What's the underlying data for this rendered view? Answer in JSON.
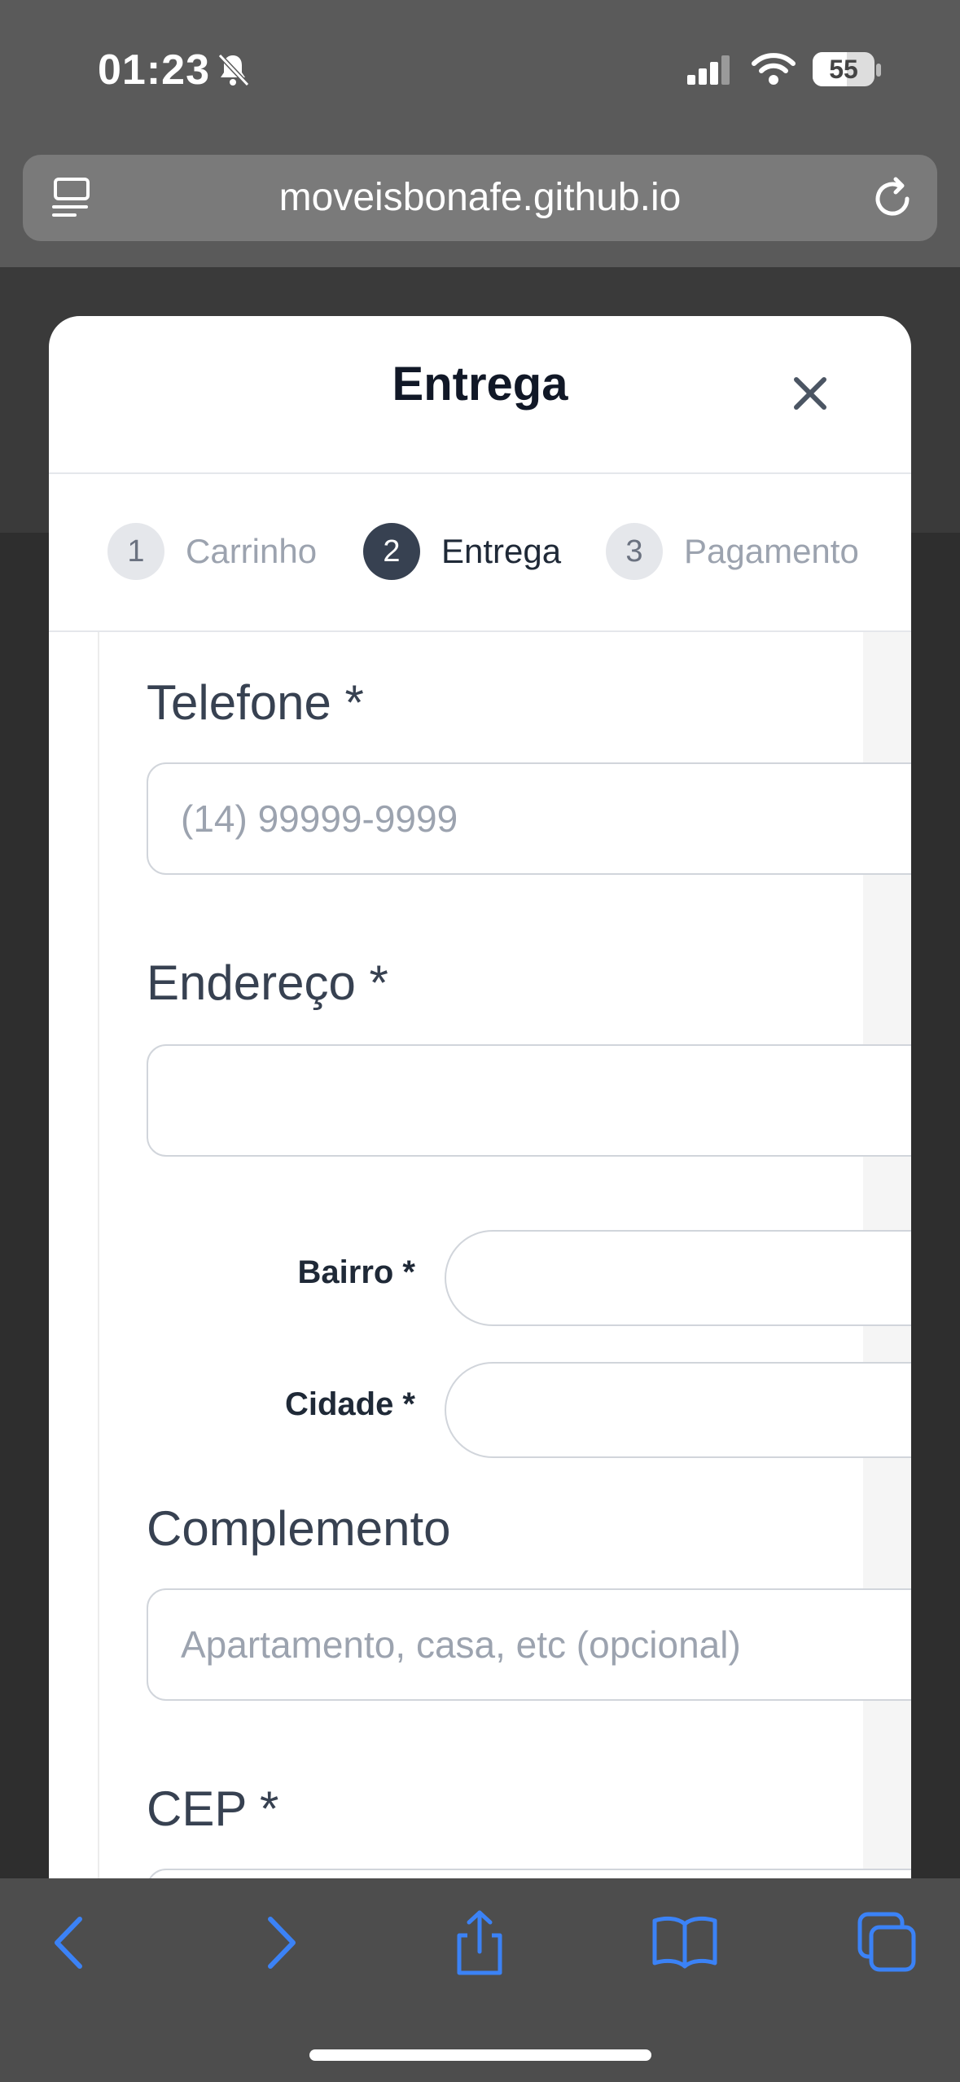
{
  "status_bar": {
    "time": "01:23",
    "battery": "55",
    "icons": [
      "bell-slash-icon",
      "signal-icon",
      "wifi-icon",
      "battery-icon"
    ]
  },
  "browser": {
    "url": "moveisbonafe.github.io",
    "icons": [
      "reader-icon",
      "reload-icon"
    ]
  },
  "modal": {
    "title": "Entrega",
    "close_icon": "close-icon",
    "steps": [
      {
        "number": "1",
        "label": "Carrinho",
        "state": "inactive"
      },
      {
        "number": "2",
        "label": "Entrega",
        "state": "active"
      },
      {
        "number": "3",
        "label": "Pagamento",
        "state": "inactive"
      }
    ]
  },
  "form": {
    "telefone_label": "Telefone *",
    "telefone_placeholder": "(14) 99999-9999",
    "endereco_label": "Endereço *",
    "endereco_value": "",
    "bairro_label": "Bairro *",
    "bairro_value": "",
    "cidade_label": "Cidade *",
    "cidade_value": "",
    "complemento_label": "Complemento",
    "complemento_placeholder": "Apartamento, casa, etc (opcional)",
    "cep_label": "CEP *"
  },
  "toolbar": {
    "icons": [
      "back-icon",
      "forward-icon",
      "share-icon",
      "bookmarks-icon",
      "tabs-icon"
    ]
  },
  "colors": {
    "active_step": "#374151",
    "inactive_step_bg": "#e5e7eb",
    "toolbar_accent": "#3b82f6"
  }
}
